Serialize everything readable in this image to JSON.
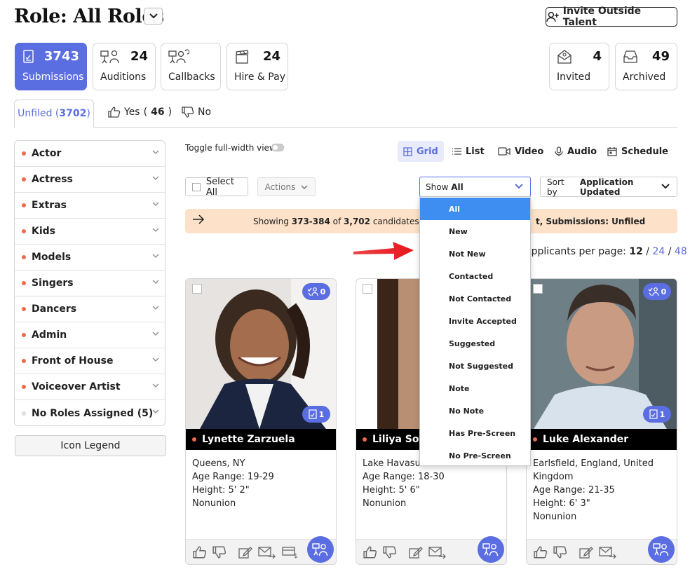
{
  "header": {
    "title": "Role: All Roles",
    "invite_label": "Invite Outside Talent"
  },
  "stats": {
    "submissions": {
      "label": "Submissions",
      "count": "3743"
    },
    "auditions": {
      "label": "Auditions",
      "count": "24"
    },
    "callbacks": {
      "label": "Callbacks",
      "count": ""
    },
    "hire_pay": {
      "label": "Hire & Pay",
      "count": "24"
    },
    "invited": {
      "label": "Invited",
      "count": "4"
    },
    "archived": {
      "label": "Archived",
      "count": "49"
    }
  },
  "tabs": {
    "unfiled": {
      "label": "Unfiled",
      "count": "3702"
    },
    "yes": {
      "label": "Yes",
      "count": "46"
    },
    "no": {
      "label": "No"
    }
  },
  "sidebar": {
    "items": [
      {
        "label": "Actor"
      },
      {
        "label": "Actress"
      },
      {
        "label": "Extras"
      },
      {
        "label": "Kids"
      },
      {
        "label": "Models"
      },
      {
        "label": "Singers"
      },
      {
        "label": "Dancers"
      },
      {
        "label": "Admin"
      },
      {
        "label": "Front of House"
      },
      {
        "label": "Voiceover Artist"
      },
      {
        "label": "No Roles Assigned (5)"
      }
    ],
    "legend_label": "Icon Legend"
  },
  "toolbar": {
    "toggle_label": "Toggle full-width view",
    "views": {
      "grid": "Grid",
      "list": "List",
      "video": "Video",
      "audio": "Audio",
      "schedule": "Schedule"
    },
    "select_all": "Select All",
    "actions": "Actions",
    "show_prefix": "Show",
    "show_value": "All",
    "sort_prefix": "Sort by",
    "sort_value": "Application Updated"
  },
  "banner": {
    "pre": "Showing ",
    "range": "373-384",
    "of": " of ",
    "total": "3,702",
    "post": " candidates wi",
    "tail_pre": "t,  ",
    "tail": "Submissions: Unfiled"
  },
  "per_page": {
    "label": "Applicants per page:",
    "current": "12",
    "opt2": "24",
    "opt3": "48"
  },
  "filter_dropdown": {
    "options": [
      "All",
      "New",
      "Not New",
      "Contacted",
      "Not Contacted",
      "Invite Accepted",
      "Suggested",
      "Not Suggested",
      "Note",
      "No Note",
      "Has Pre-Screen",
      "No Pre-Screen"
    ],
    "selected": "All"
  },
  "cards": [
    {
      "name": "Lynette Zarzuela",
      "location": "Queens, NY",
      "age": "Age Range: 19-29",
      "height": "Height: 5' 2\"",
      "union": "Nonunion",
      "badge_top": "0",
      "badge_bottom": "1"
    },
    {
      "name": "Liliya Sote",
      "location": "Lake Havasu",
      "age": "Age Range: 18-30",
      "height": "Height: 5' 6\"",
      "union": "Nonunion"
    },
    {
      "name": "Luke Alexander",
      "location": "Earlsfield, England, United",
      "location2": "Kingdom",
      "age": "Age Range: 21-35",
      "height": "Height: 6' 3\"",
      "union": "Nonunion",
      "badge_top": "0",
      "badge_bottom": "1"
    }
  ],
  "colors": {
    "accent": "#5b6ee1",
    "dropdown_selected": "#3d8ef0",
    "banner_bg": "#fde1c8",
    "dot": "#f06a4d",
    "arrow": "#e8141b"
  }
}
